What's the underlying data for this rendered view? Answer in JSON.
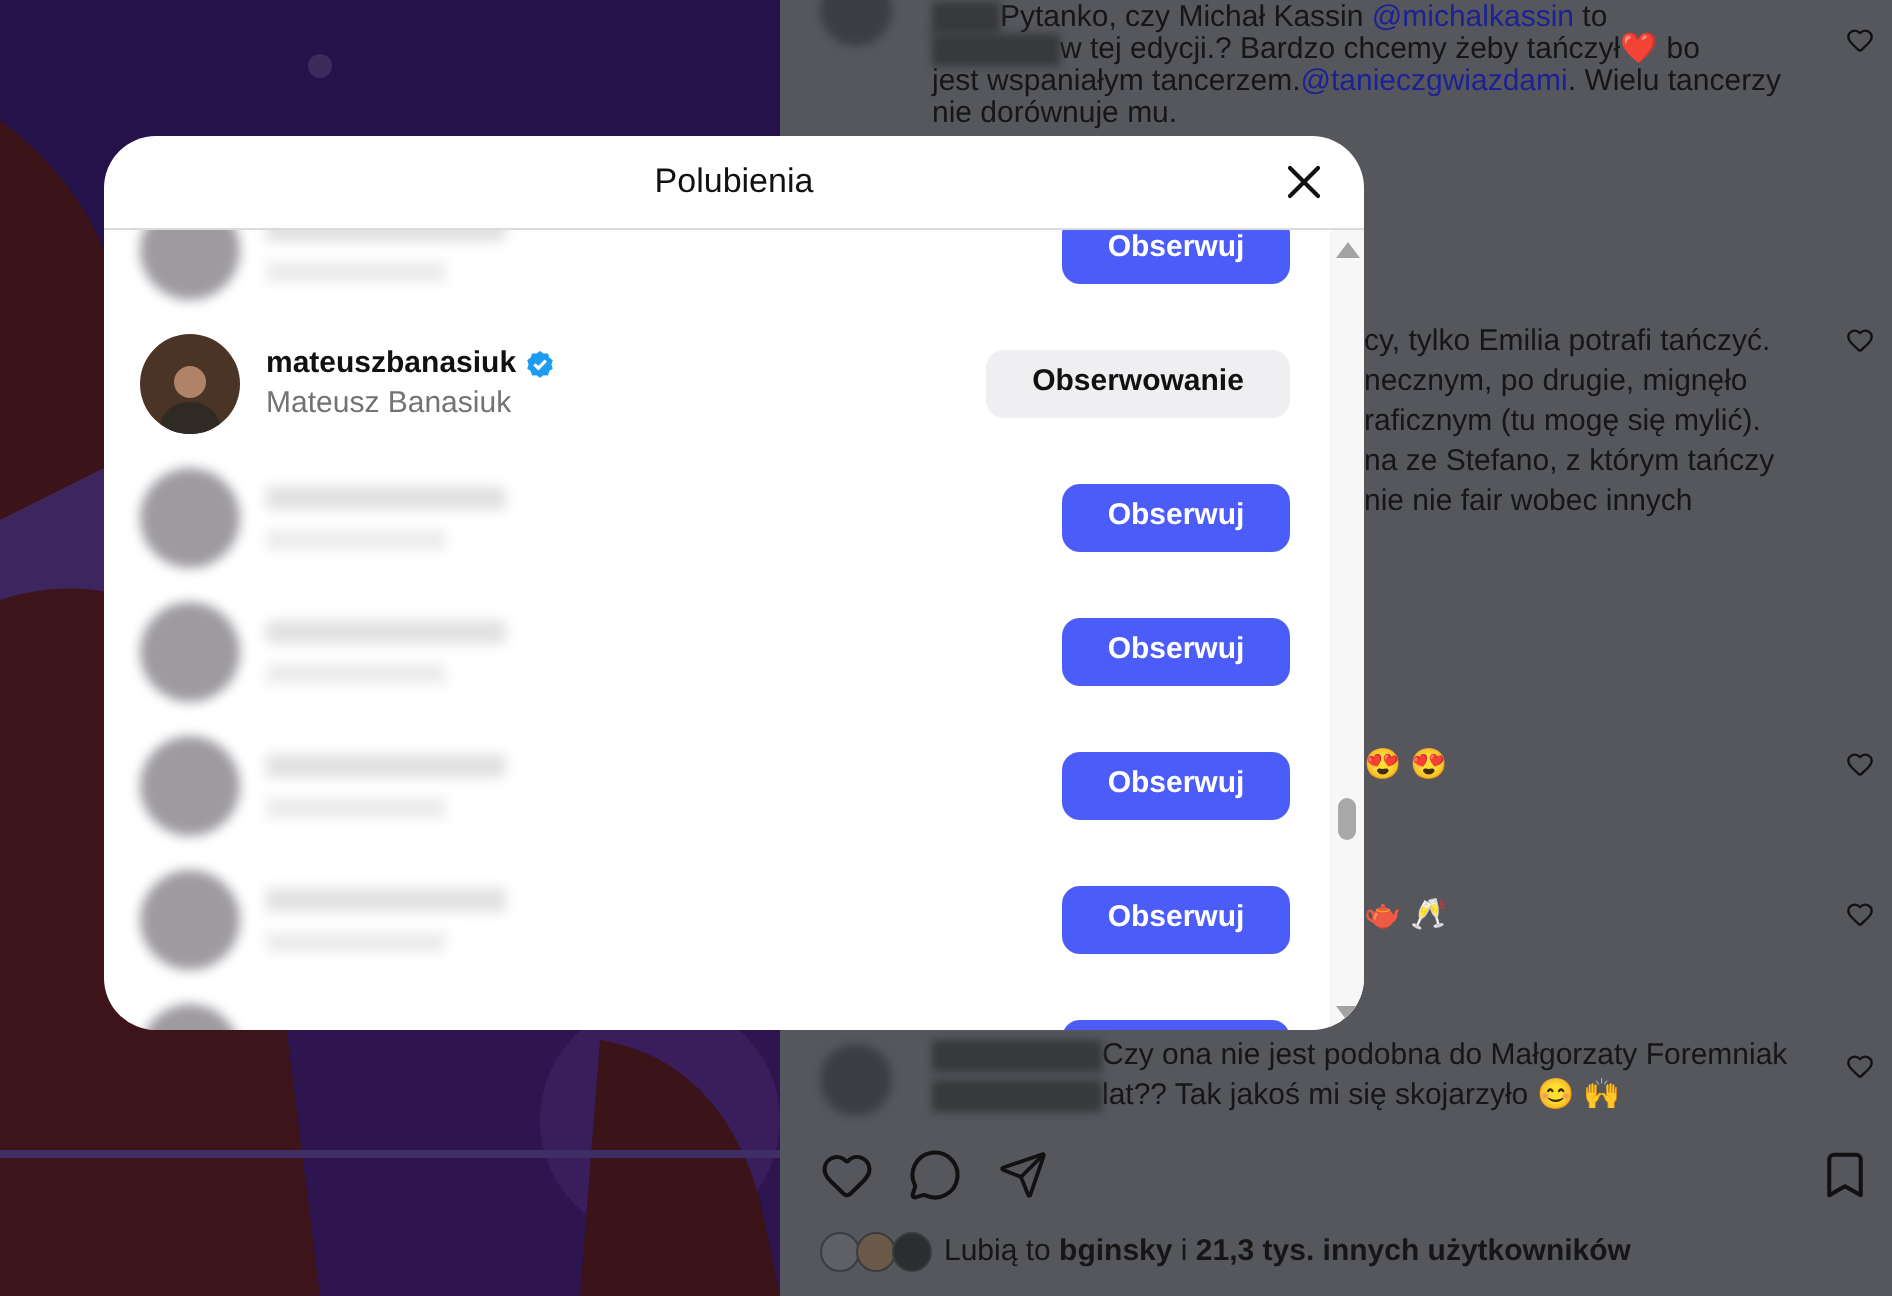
{
  "comments": [
    {
      "kind": "full",
      "heart": true,
      "lines": [
        {
          "kind": "after_name",
          "segments": [
            {
              "kind": "text",
              "text": "Pytanko, czy Michał Kassin "
            },
            {
              "kind": "mention",
              "text": "@michalkassin"
            },
            {
              "kind": "text",
              "text": " to"
            }
          ]
        },
        {
          "kind": "after_name",
          "segments": [
            {
              "kind": "text",
              "text": "w tej edycji.? Bardzo chcemy żeby tańczył❤️ bo"
            }
          ]
        },
        {
          "kind": "plain",
          "segments": [
            {
              "kind": "text",
              "text": "jest wspaniałym tancerzem."
            },
            {
              "kind": "mention",
              "text": "@tanieczgwiazdami"
            },
            {
              "kind": "text",
              "text": ". Wielu tancerzy"
            }
          ]
        },
        {
          "kind": "plain",
          "segments": [
            {
              "kind": "text",
              "text": "nie dorównuje mu."
            }
          ]
        }
      ]
    },
    {
      "kind": "clipped",
      "heart": true,
      "lines": [
        {
          "kind": "past_modal",
          "segments": [
            {
              "kind": "text",
              "text": "cy, tylko Emilia potrafi tańczyć."
            }
          ]
        },
        {
          "kind": "past_modal",
          "segments": [
            {
              "kind": "text",
              "text": "necznym, po drugie, mignęło"
            }
          ]
        },
        {
          "kind": "past_modal",
          "segments": [
            {
              "kind": "text",
              "text": "raficznym (tu mogę się mylić)."
            }
          ]
        },
        {
          "kind": "past_modal",
          "segments": [
            {
              "kind": "text",
              "text": "na ze Stefano, z którym tańczy"
            }
          ]
        },
        {
          "kind": "past_modal",
          "segments": [
            {
              "kind": "text",
              "text": "nie nie fair wobec innych"
            }
          ]
        }
      ]
    },
    {
      "kind": "clipped",
      "heart": true,
      "lines": [
        {
          "kind": "past_modal",
          "segments": [
            {
              "kind": "text",
              "text": "😍 😍"
            }
          ]
        }
      ]
    },
    {
      "kind": "clipped",
      "heart": true,
      "lines": [
        {
          "kind": "past_modal",
          "segments": [
            {
              "kind": "text",
              "text": "🫖 🥂"
            }
          ]
        }
      ]
    },
    {
      "kind": "full",
      "heart": true,
      "lines": [
        {
          "kind": "after_name",
          "segments": [
            {
              "kind": "text",
              "text": "Czy ona nie jest podobna do Małgorzaty Foremniak"
            }
          ]
        },
        {
          "kind": "after_name",
          "segments": [
            {
              "kind": "text",
              "text": "lat?? Tak jakoś mi się skojarzyło 😊 🙌"
            }
          ]
        }
      ]
    }
  ],
  "likes": {
    "text": "Lubią to **bginsky** i **21,3 tys. innych użytkowników**"
  },
  "modal": {
    "title": "Polubienia",
    "users": [
      {
        "kind": "blurred",
        "button": {
          "label": "Obserwuj",
          "following": false
        }
      },
      {
        "kind": "user",
        "username": "mateuszbanasiuk",
        "verified": true,
        "full_name": "Mateusz Banasiuk",
        "button": {
          "label": "Obserwowanie",
          "following": true
        }
      },
      {
        "kind": "blurred",
        "button": {
          "label": "Obserwuj",
          "following": false
        }
      },
      {
        "kind": "blurred",
        "button": {
          "label": "Obserwuj",
          "following": false
        }
      },
      {
        "kind": "blurred",
        "button": {
          "label": "Obserwuj",
          "following": false
        }
      },
      {
        "kind": "blurred",
        "button": {
          "label": "Obserwuj",
          "following": false
        }
      },
      {
        "kind": "cut"
      }
    ]
  }
}
